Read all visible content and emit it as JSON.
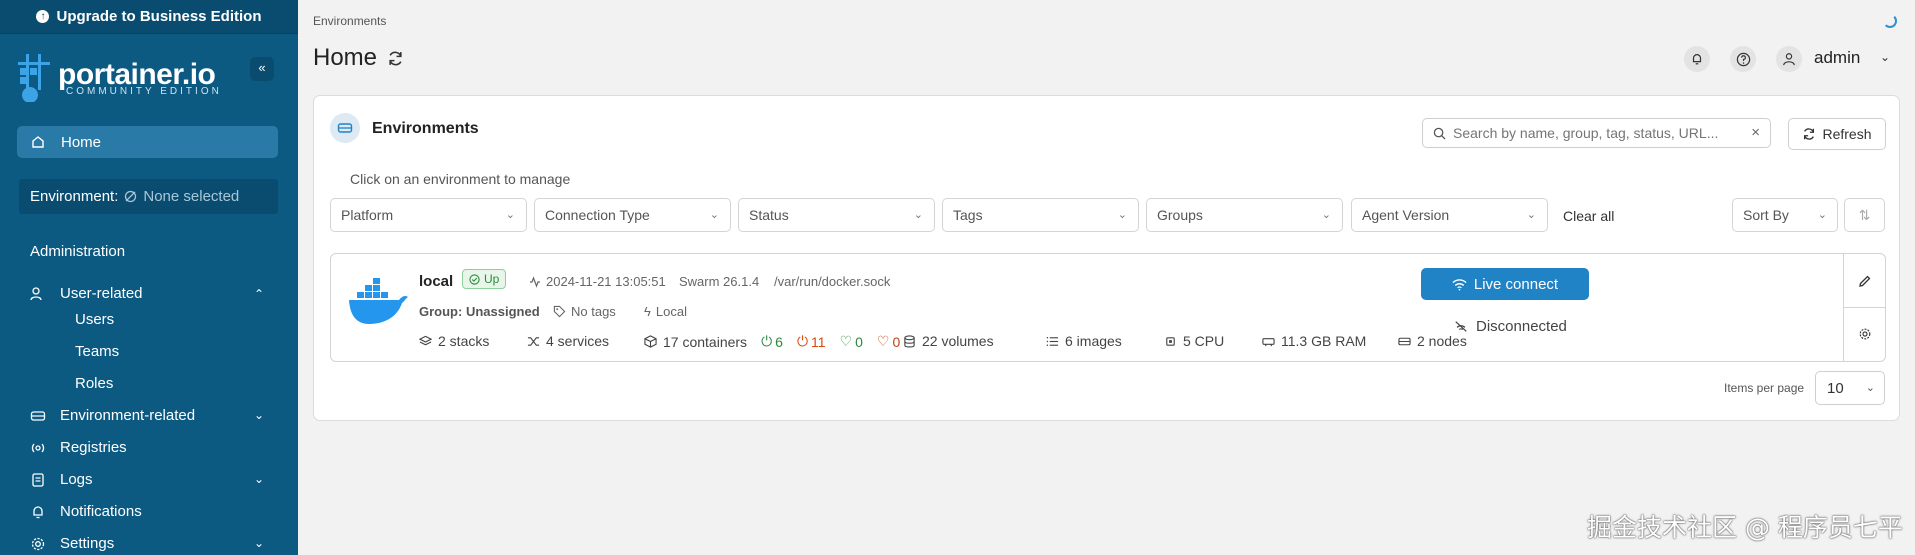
{
  "sidebar": {
    "upgrade_label": "Upgrade to Business Edition",
    "logo_text": "portainer.io",
    "logo_sub": "COMMUNITY EDITION",
    "collapse_glyph": "«",
    "home_label": "Home",
    "environment_label": "Environment:",
    "environment_value": "None selected",
    "administration_label": "Administration",
    "items": [
      {
        "label": "User-related",
        "icon": "users-icon",
        "expanded": true
      },
      {
        "label": "Users"
      },
      {
        "label": "Teams"
      },
      {
        "label": "Roles"
      },
      {
        "label": "Environment-related",
        "icon": "hdd-icon",
        "expanded": false
      },
      {
        "label": "Registries",
        "icon": "radio-icon"
      },
      {
        "label": "Logs",
        "icon": "list-icon",
        "expanded": false
      },
      {
        "label": "Notifications",
        "icon": "bell-icon"
      },
      {
        "label": "Settings",
        "icon": "gear-icon",
        "expanded": false
      }
    ]
  },
  "header": {
    "breadcrumb": "Environments",
    "title": "Home",
    "user_name": "admin"
  },
  "panel": {
    "title": "Environments",
    "search_placeholder": "Search by name, group, tag, status, URL...",
    "refresh_label": "Refresh",
    "hint": "Click on an environment to manage",
    "filters": [
      "Platform",
      "Connection Type",
      "Status",
      "Tags",
      "Groups",
      "Agent Version"
    ],
    "clear_all": "Clear all",
    "sort_by": "Sort By",
    "items_per_page_label": "Items per page",
    "items_per_page_value": "10"
  },
  "environment": {
    "name": "local",
    "status": "Up",
    "timestamp": "2024-11-21 13:05:51",
    "version": "Swarm 26.1.4",
    "socket": "/var/run/docker.sock",
    "group_label": "Group:",
    "group_value": "Unassigned",
    "tags": "No tags",
    "type": "Local",
    "stacks": "2 stacks",
    "services": "4 services",
    "containers": "17 containers",
    "running": "6",
    "stopped": "11",
    "healthy": "0",
    "unhealthy": "0",
    "volumes": "22 volumes",
    "images": "6 images",
    "cpu": "5 CPU",
    "ram": "11.3 GB RAM",
    "nodes": "2 nodes",
    "live_connect": "Live connect",
    "connection_status": "Disconnected"
  },
  "colors": {
    "sidebar_bg": "#0c5982",
    "primary": "#1f83c6",
    "status_up": "#2b8a3e",
    "stopped": "#d9480f"
  },
  "watermark": "掘金技术社区 @ 程序员七平"
}
